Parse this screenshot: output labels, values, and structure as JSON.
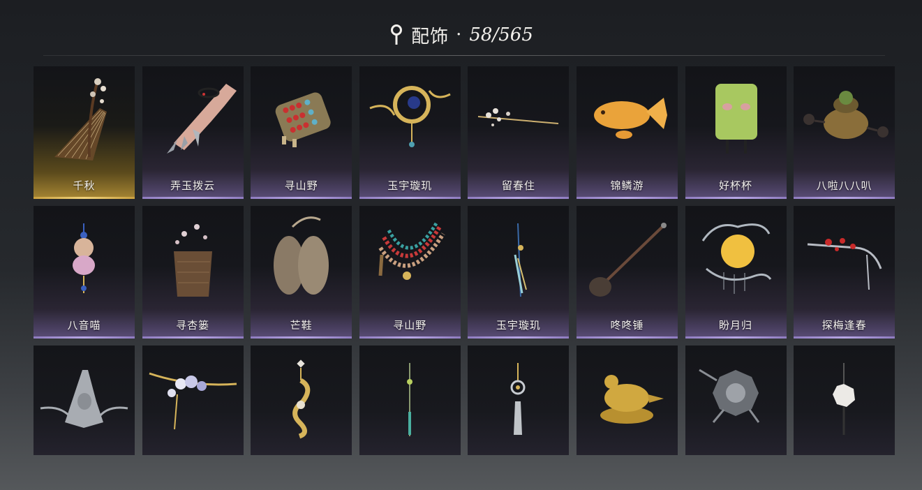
{
  "header": {
    "title": "配饰",
    "separator": "·",
    "count": "58/565",
    "icon": "location-pin-icon"
  },
  "items": [
    {
      "label": "千秋",
      "icon": "guzheng-icon",
      "rarity": "gold"
    },
    {
      "label": "弄玉拨云",
      "icon": "claw-bracelet-icon",
      "rarity": "purple"
    },
    {
      "label": "寻山野",
      "icon": "beaded-cuff-icon",
      "rarity": "purple"
    },
    {
      "label": "玉宇璇玑",
      "icon": "armillary-ornament-icon",
      "rarity": "purple"
    },
    {
      "label": "留春住",
      "icon": "flower-hairpin-icon",
      "rarity": "purple"
    },
    {
      "label": "锦鳞游",
      "icon": "golden-fish-icon",
      "rarity": "purple"
    },
    {
      "label": "好杯杯",
      "icon": "cup-creature-icon",
      "rarity": "purple"
    },
    {
      "label": "八啦八八叭",
      "icon": "drum-creature-icon",
      "rarity": "purple"
    },
    {
      "label": "八音喵",
      "icon": "cat-pendant-icon",
      "rarity": "purple"
    },
    {
      "label": "寻杏篓",
      "icon": "apricot-basket-icon",
      "rarity": "purple"
    },
    {
      "label": "芒鞋",
      "icon": "straw-sandals-icon",
      "rarity": "purple"
    },
    {
      "label": "寻山野",
      "icon": "bead-necklace-icon",
      "rarity": "purple"
    },
    {
      "label": "玉宇璇玑",
      "icon": "tassel-pendant-icon",
      "rarity": "purple"
    },
    {
      "label": "咚咚锤",
      "icon": "mallet-icon",
      "rarity": "purple"
    },
    {
      "label": "盼月归",
      "icon": "moon-ornament-icon",
      "rarity": "purple"
    },
    {
      "label": "探梅逢春",
      "icon": "plum-hairpin-icon",
      "rarity": "purple"
    },
    {
      "label": "",
      "icon": "silver-crown-icon",
      "rarity": "none"
    },
    {
      "label": "",
      "icon": "orchid-hairpin-icon",
      "rarity": "none"
    },
    {
      "label": "",
      "icon": "gold-swirl-earring-icon",
      "rarity": "none"
    },
    {
      "label": "",
      "icon": "jade-tassel-icon",
      "rarity": "none"
    },
    {
      "label": "",
      "icon": "ring-tassel-icon",
      "rarity": "none"
    },
    {
      "label": "",
      "icon": "golden-bird-icon",
      "rarity": "none"
    },
    {
      "label": "",
      "icon": "bagua-mirror-icon",
      "rarity": "none"
    },
    {
      "label": "",
      "icon": "white-charm-icon",
      "rarity": "none"
    }
  ],
  "colors": {
    "gold_accent": "#f0d27a",
    "purple_accent": "#b7a6e4",
    "background": "#1c1e22"
  }
}
